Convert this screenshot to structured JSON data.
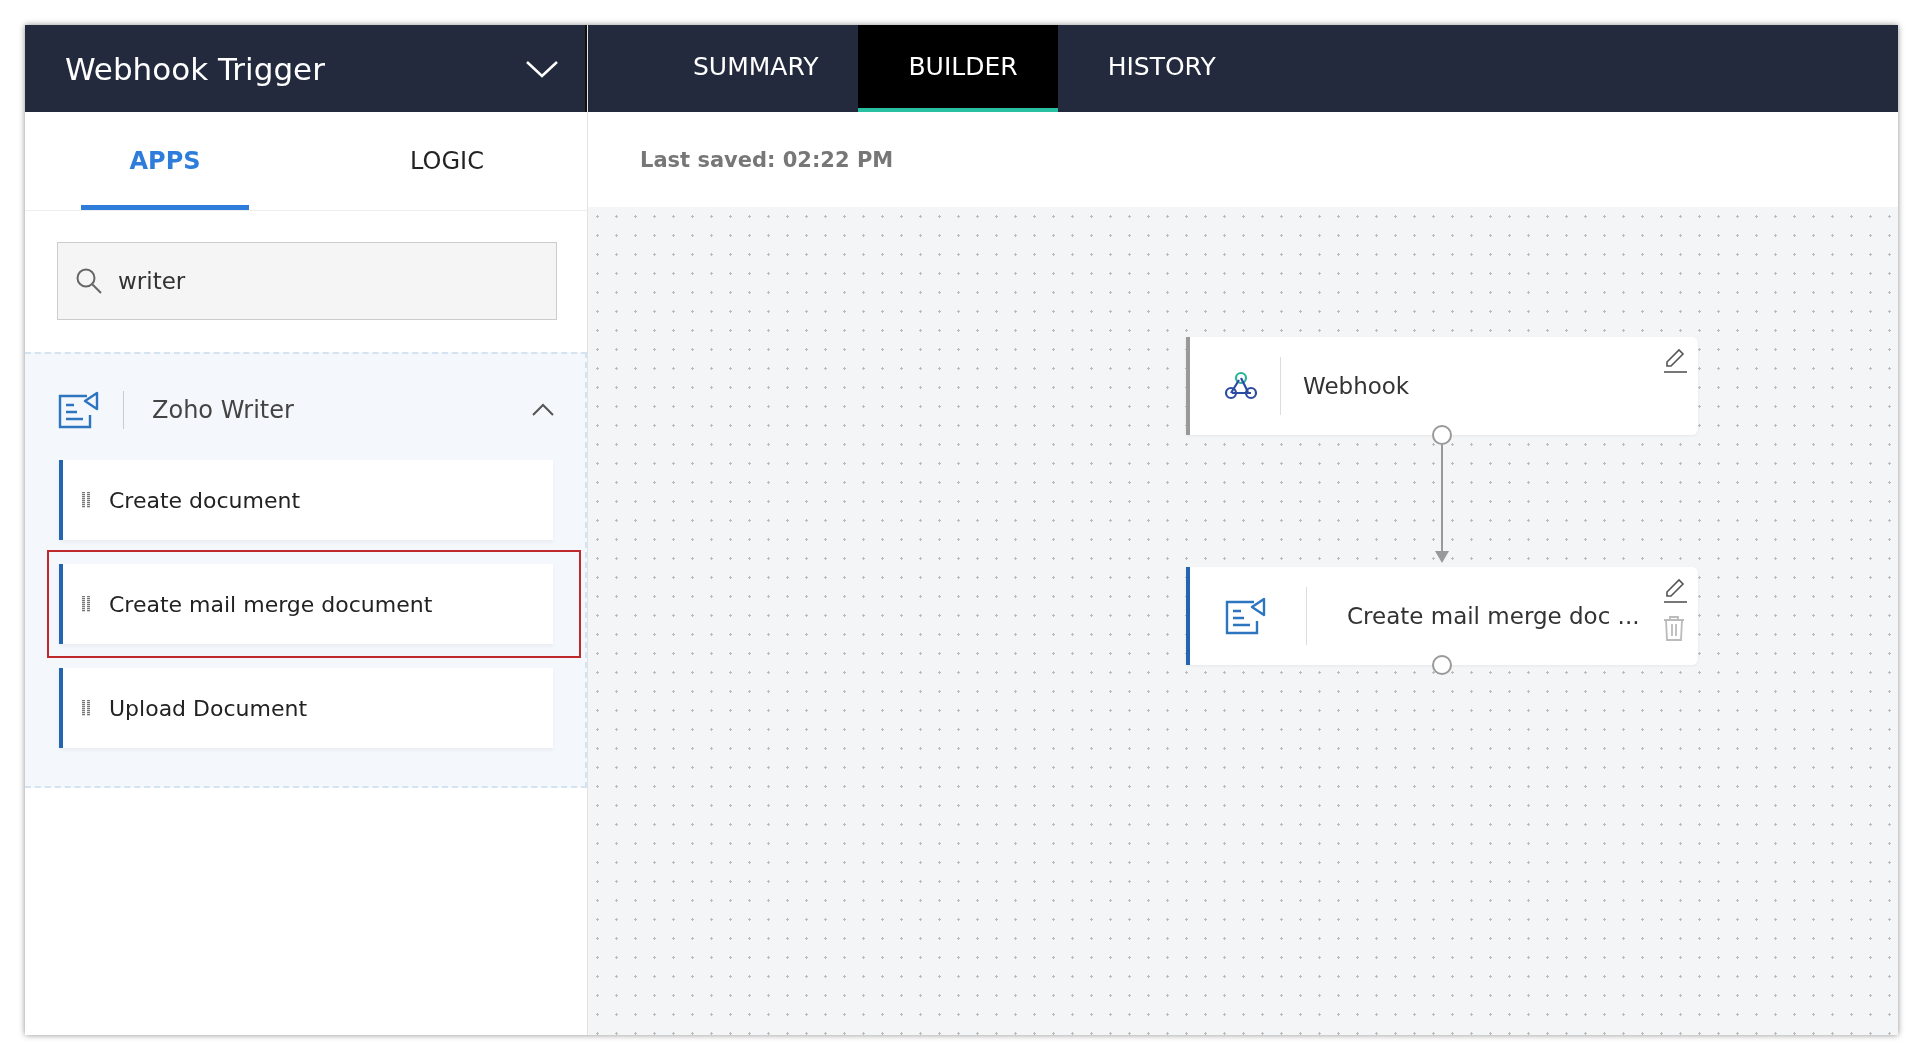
{
  "header": {
    "title": "Webhook Trigger",
    "tabs": [
      {
        "label": "SUMMARY",
        "selected": false
      },
      {
        "label": "BUILDER",
        "selected": true
      },
      {
        "label": "HISTORY",
        "selected": false
      }
    ]
  },
  "sidebar": {
    "tabs": [
      {
        "label": "APPS",
        "selected": true
      },
      {
        "label": "LOGIC",
        "selected": false
      }
    ],
    "search": {
      "value": "writer"
    },
    "app_group": {
      "name": "Zoho Writer",
      "expanded": true,
      "actions": [
        {
          "label": "Create document",
          "highlighted": false
        },
        {
          "label": "Create mail merge document",
          "highlighted": true
        },
        {
          "label": "Upload Document",
          "highlighted": false
        }
      ]
    }
  },
  "canvas": {
    "last_saved": "Last saved: 02:22 PM",
    "nodes": [
      {
        "kind": "trigger",
        "label": "Webhook",
        "deletable": false
      },
      {
        "kind": "action",
        "label": "Create mail merge doc ...",
        "deletable": true
      }
    ]
  }
}
